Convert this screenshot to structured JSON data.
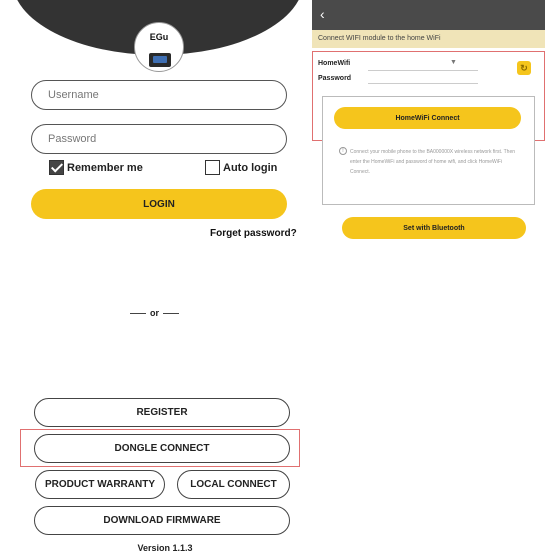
{
  "login": {
    "logo_text": "EGu",
    "username_placeholder": "Username",
    "password_placeholder": "Password",
    "remember_label": "Remember me",
    "remember_checked": true,
    "auto_login_label": "Auto login",
    "auto_login_checked": false,
    "login_button": "LOGIN",
    "forget_password": "Forget password?",
    "or_text": "or",
    "register_button": "REGISTER",
    "dongle_button": "DONGLE CONNECT",
    "warranty_button": "PRODUCT WARRANTY",
    "local_connect_button": "LOCAL CONNECT",
    "firmware_button": "DOWNLOAD FIRMWARE",
    "version": "Version 1.1.3",
    "accent_color": "#f5c51c",
    "highlight_color": "#e07070"
  },
  "wifi_config": {
    "back_icon": "chevron-left-icon",
    "title": "Connect WIFI module to the home WiFi",
    "homewifi_label": "HomeWifi",
    "password_label": "Password",
    "dropdown_icon": "triangle-down-icon",
    "refresh_icon": "refresh-icon",
    "home_connect_button": "HomeWiFi Connect",
    "info_text": "Connect your mobile phone to the BA000000X wireless network first. Then enter the HomeWiFi and password of home wifi, and click HomeWiFi Connect.",
    "bluetooth_button": "Set with Bluetooth"
  }
}
